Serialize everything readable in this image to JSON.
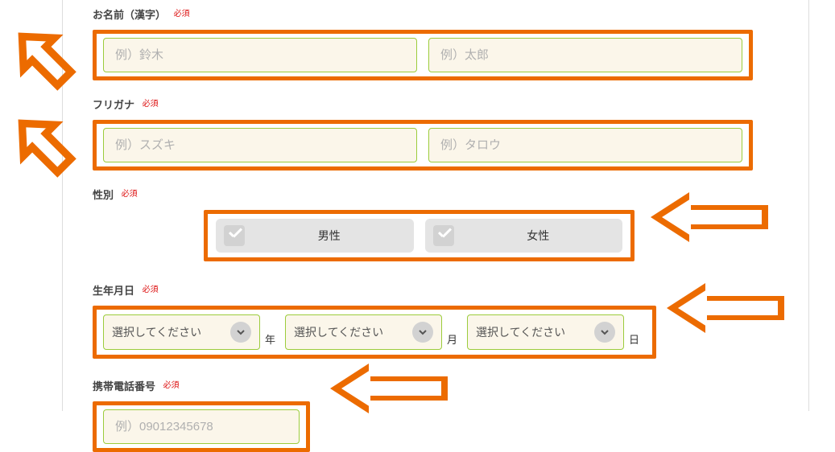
{
  "name": {
    "label": "お名前（漢字）",
    "required": "必須",
    "placeholder_last": "例）鈴木",
    "placeholder_first": "例）太郎"
  },
  "furigana": {
    "label": "フリガナ",
    "required": "必須",
    "placeholder_last": "例）スズキ",
    "placeholder_first": "例）タロウ"
  },
  "gender": {
    "label": "性別",
    "required": "必須",
    "male": "男性",
    "female": "女性"
  },
  "dob": {
    "label": "生年月日",
    "required": "必須",
    "select_placeholder": "選択してください",
    "unit_year": "年",
    "unit_month": "月",
    "unit_day": "日"
  },
  "phone": {
    "label": "携帯電話番号",
    "required": "必須",
    "placeholder": "例）09012345678"
  }
}
